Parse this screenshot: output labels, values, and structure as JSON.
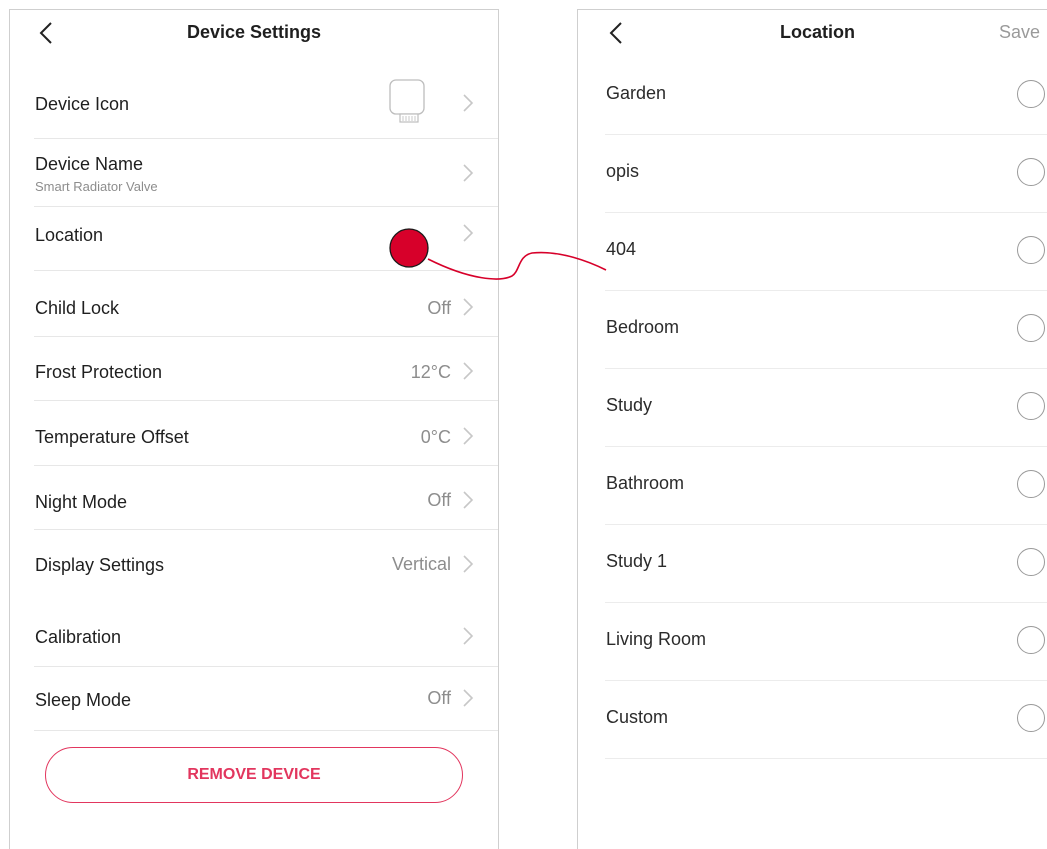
{
  "device_settings": {
    "title": "Device Settings",
    "rows": [
      {
        "label": "Device Icon",
        "sub": "",
        "value": ""
      },
      {
        "label": "Device Name",
        "sub": "Smart Radiator Valve",
        "value": ""
      },
      {
        "label": "Location",
        "sub": "",
        "value": ""
      },
      {
        "label": "Child Lock",
        "sub": "",
        "value": "Off"
      },
      {
        "label": "Frost Protection",
        "sub": "",
        "value": "12°C"
      },
      {
        "label": "Temperature Offset",
        "sub": "",
        "value": "0°C"
      },
      {
        "label": "Night Mode",
        "sub": "",
        "value": "Off"
      },
      {
        "label": "Display Settings",
        "sub": "",
        "value": "Vertical"
      },
      {
        "label": "Calibration",
        "sub": "",
        "value": ""
      },
      {
        "label": "Sleep Mode",
        "sub": "",
        "value": "Off"
      }
    ],
    "remove_label": "REMOVE DEVICE"
  },
  "location": {
    "title": "Location",
    "save_label": "Save",
    "options": [
      {
        "label": "Garden",
        "selected": false
      },
      {
        "label": "opis",
        "selected": false
      },
      {
        "label": "404",
        "selected": false
      },
      {
        "label": "Bedroom",
        "selected": false
      },
      {
        "label": "Study",
        "selected": false
      },
      {
        "label": "Bathroom",
        "selected": false
      },
      {
        "label": "Study 1",
        "selected": false
      },
      {
        "label": "Living Room",
        "selected": false
      },
      {
        "label": "Custom",
        "selected": false
      }
    ]
  },
  "icons": {
    "back": "chevron-left-icon",
    "row_arrow": "chevron-right-icon",
    "device": "radiator-valve-icon",
    "radio": "radio-unchecked-icon",
    "annotation": "red-dot-marker"
  },
  "colors": {
    "accent": "#e2365e",
    "marker": "#d7002a",
    "secondary_text": "#8d8d8d",
    "divider": "#e7e7e7"
  }
}
